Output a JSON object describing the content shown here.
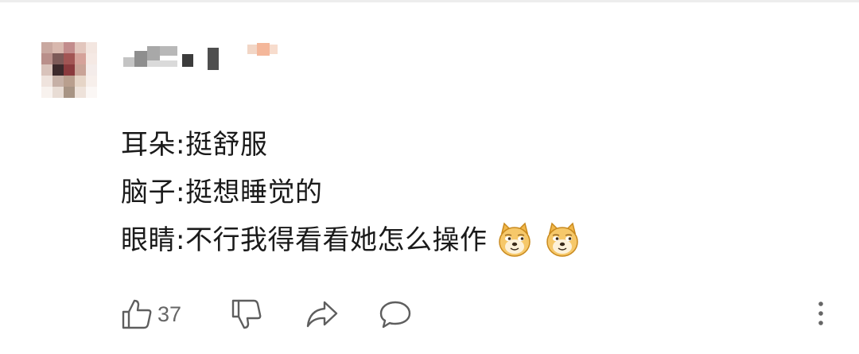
{
  "comment": {
    "lines": [
      "耳朵:挺舒服",
      "脑子:挺想睡觉的",
      "眼睛:不行我得看看她怎么操作"
    ],
    "emoji": [
      "doge-icon",
      "doge-icon"
    ]
  },
  "actions": {
    "like_count": "37",
    "icons": [
      "thumbs-up-icon",
      "thumbs-down-icon",
      "share-icon",
      "comment-icon",
      "more-vertical-icon"
    ]
  },
  "colors": {
    "text": "#1a1a1a",
    "icon": "#5e5e5e",
    "doge_fill": "#f6c86a"
  }
}
